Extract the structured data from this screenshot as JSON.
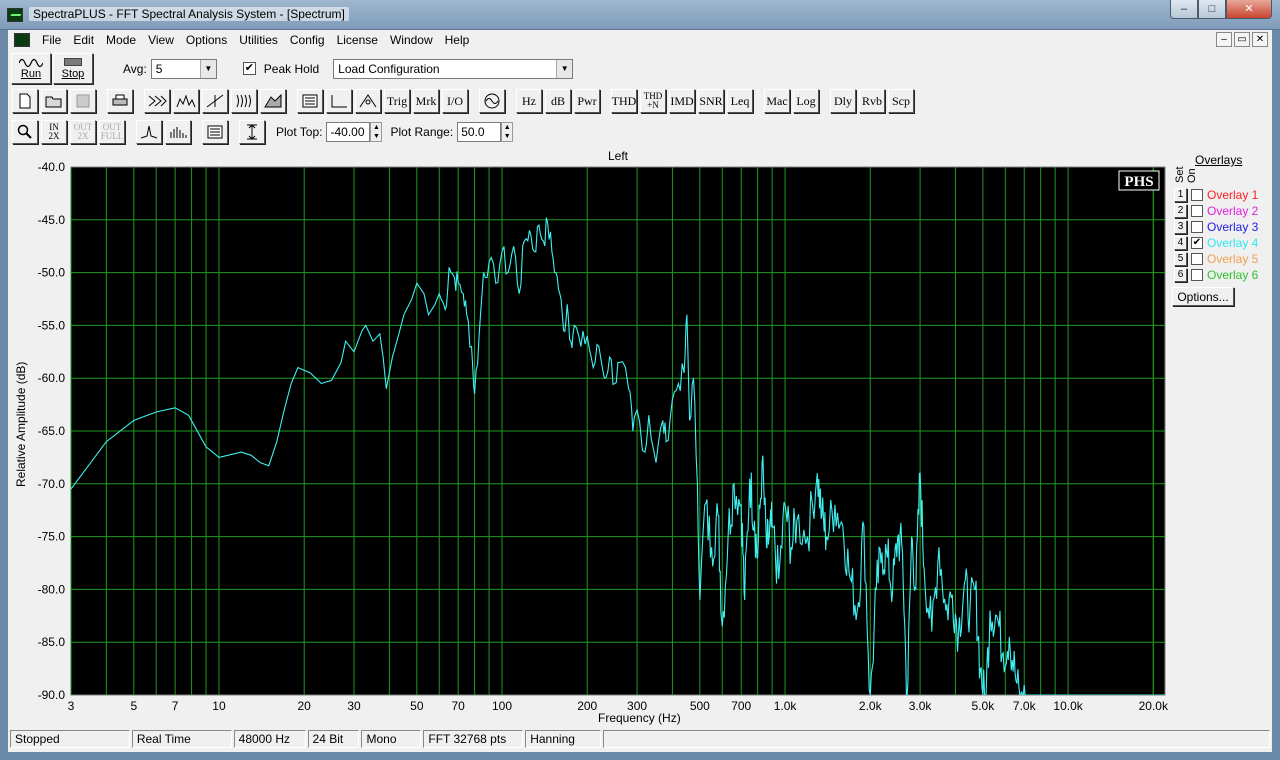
{
  "window": {
    "title": "SpectraPLUS - FFT Spectral Analysis System - [Spectrum]",
    "minimize": "–",
    "maximize": "□",
    "close": "✕"
  },
  "menu": [
    "File",
    "Edit",
    "Mode",
    "View",
    "Options",
    "Utilities",
    "Config",
    "License",
    "Window",
    "Help"
  ],
  "mdi": {
    "min": "–",
    "restore": "▭",
    "close": "✕"
  },
  "toolbar": {
    "run_label": "Run",
    "stop_label": "Stop",
    "avg_label": "Avg:",
    "avg_value": "5",
    "peak_hold_label": "Peak Hold",
    "peak_hold_checked": "✔",
    "config_value": "Load Configuration",
    "row2_text_buttons": [
      "Trig",
      "Mrk",
      "I/O"
    ],
    "units": [
      "Hz",
      "dB",
      "Pwr"
    ],
    "measures": [
      "THD",
      "THD +N",
      "IMD",
      "SNR",
      "Leq"
    ],
    "modes": [
      "Mac",
      "Log"
    ],
    "utils": [
      "Dly",
      "Rvb",
      "Scp"
    ],
    "plot_top_label": "Plot Top:",
    "plot_top_value": "-40.00",
    "plot_range_label": "Plot Range:",
    "plot_range_value": "50.0"
  },
  "overlays": {
    "title": "Overlays",
    "set_label": "Set",
    "on_label": "On",
    "options_label": "Options...",
    "items": [
      {
        "num": "1",
        "name": "Overlay 1",
        "color": "#ff2020",
        "checked": ""
      },
      {
        "num": "2",
        "name": "Overlay 2",
        "color": "#e020e0",
        "checked": ""
      },
      {
        "num": "3",
        "name": "Overlay 3",
        "color": "#2020e0",
        "checked": ""
      },
      {
        "num": "4",
        "name": "Overlay 4",
        "color": "#30e8f0",
        "checked": "✔"
      },
      {
        "num": "5",
        "name": "Overlay 5",
        "color": "#f0a050",
        "checked": ""
      },
      {
        "num": "6",
        "name": "Overlay 6",
        "color": "#30c030",
        "checked": ""
      }
    ]
  },
  "status": [
    "Stopped",
    "Real Time",
    "48000 Hz",
    "24 Bit",
    "Mono",
    "FFT 32768 pts",
    "Hanning"
  ],
  "chart_data": {
    "type": "line",
    "title": "Left",
    "xlabel": "Frequency (Hz)",
    "ylabel": "Relative Amplitude (dB)",
    "xscale": "log",
    "xlim": [
      3,
      22000
    ],
    "ylim": [
      -90,
      -40
    ],
    "grid": true,
    "background": "#000000",
    "grid_color": "#1f9a1f",
    "line_color": "#40f0f0",
    "watermark": "PHS",
    "y_ticks": [
      "-40.0",
      "-45.0",
      "-50.0",
      "-55.0",
      "-60.0",
      "-65.0",
      "-70.0",
      "-75.0",
      "-80.0",
      "-85.0",
      "-90.0"
    ],
    "x_ticks": [
      {
        "v": 3,
        "t": "3"
      },
      {
        "v": 5,
        "t": "5"
      },
      {
        "v": 7,
        "t": "7"
      },
      {
        "v": 10,
        "t": "10"
      },
      {
        "v": 20,
        "t": "20"
      },
      {
        "v": 30,
        "t": "30"
      },
      {
        "v": 50,
        "t": "50"
      },
      {
        "v": 70,
        "t": "70"
      },
      {
        "v": 100,
        "t": "100"
      },
      {
        "v": 200,
        "t": "200"
      },
      {
        "v": 300,
        "t": "300"
      },
      {
        "v": 500,
        "t": "500"
      },
      {
        "v": 700,
        "t": "700"
      },
      {
        "v": 1000,
        "t": "1.0k"
      },
      {
        "v": 2000,
        "t": "2.0k"
      },
      {
        "v": 3000,
        "t": "3.0k"
      },
      {
        "v": 5000,
        "t": "5.0k"
      },
      {
        "v": 7000,
        "t": "7.0k"
      },
      {
        "v": 10000,
        "t": "10.0k"
      },
      {
        "v": 20000,
        "t": "20.0k"
      }
    ],
    "series": [
      {
        "name": "Left",
        "points": [
          [
            3,
            -70.5
          ],
          [
            4,
            -66
          ],
          [
            5,
            -64
          ],
          [
            6,
            -63.2
          ],
          [
            7,
            -62.8
          ],
          [
            7.8,
            -63.5
          ],
          [
            9,
            -66.5
          ],
          [
            10,
            -67.5
          ],
          [
            12,
            -67
          ],
          [
            13,
            -67.3
          ],
          [
            14,
            -68
          ],
          [
            15,
            -68.3
          ],
          [
            16,
            -66
          ],
          [
            17,
            -63
          ],
          [
            18,
            -60.5
          ],
          [
            19,
            -59
          ],
          [
            21,
            -59.5
          ],
          [
            23,
            -60.5
          ],
          [
            25,
            -60.2
          ],
          [
            27,
            -58.5
          ],
          [
            28,
            -56.5
          ],
          [
            30,
            -57.5
          ],
          [
            32,
            -55.5
          ],
          [
            33,
            -55
          ],
          [
            35,
            -56.5
          ],
          [
            37,
            -55.8
          ],
          [
            38,
            -58
          ],
          [
            39,
            -61
          ],
          [
            41,
            -58
          ],
          [
            43,
            -56
          ],
          [
            45,
            -54
          ],
          [
            48,
            -52.5
          ],
          [
            50,
            -51
          ],
          [
            53,
            -52
          ],
          [
            55,
            -54
          ],
          [
            58,
            -53
          ],
          [
            60,
            -52
          ],
          [
            63,
            -53.5
          ],
          [
            65,
            -49.5
          ],
          [
            68,
            -50.5
          ],
          [
            70,
            -51
          ],
          [
            73,
            -52
          ],
          [
            75,
            -54
          ],
          [
            78,
            -57
          ],
          [
            80,
            -61.5
          ],
          [
            83,
            -56
          ],
          [
            86,
            -50
          ],
          [
            90,
            -49
          ],
          [
            95,
            -51
          ],
          [
            100,
            -48
          ],
          [
            105,
            -50
          ],
          [
            110,
            -47.5
          ],
          [
            115,
            -52
          ],
          [
            120,
            -47
          ],
          [
            125,
            -46
          ],
          [
            130,
            -48
          ],
          [
            135,
            -45.5
          ],
          [
            140,
            -47
          ],
          [
            145,
            -45.3
          ],
          [
            150,
            -48
          ],
          [
            155,
            -50
          ],
          [
            160,
            -52
          ],
          [
            165,
            -55.5
          ],
          [
            170,
            -53
          ],
          [
            175,
            -56.5
          ],
          [
            180,
            -55
          ],
          [
            190,
            -57
          ],
          [
            200,
            -56
          ],
          [
            210,
            -59
          ],
          [
            220,
            -57
          ],
          [
            230,
            -60
          ],
          [
            240,
            -58
          ],
          [
            250,
            -60.5
          ],
          [
            260,
            -58.5
          ],
          [
            280,
            -61
          ],
          [
            290,
            -65
          ],
          [
            300,
            -63
          ],
          [
            320,
            -67
          ],
          [
            330,
            -63.5
          ],
          [
            350,
            -68
          ],
          [
            370,
            -64
          ],
          [
            380,
            -66
          ],
          [
            400,
            -62
          ],
          [
            420,
            -60.5
          ],
          [
            440,
            -59.5
          ],
          [
            450,
            -54
          ],
          [
            460,
            -64
          ],
          [
            475,
            -60
          ],
          [
            490,
            -70
          ],
          [
            500,
            -81
          ],
          [
            520,
            -72
          ],
          [
            550,
            -76
          ],
          [
            580,
            -73
          ],
          [
            600,
            -83.5
          ],
          [
            630,
            -74.5
          ],
          [
            660,
            -70
          ],
          [
            700,
            -72
          ],
          [
            720,
            -81
          ],
          [
            750,
            -69.5
          ],
          [
            780,
            -73.5
          ],
          [
            800,
            -77
          ],
          [
            830,
            -68
          ],
          [
            860,
            -76
          ],
          [
            880,
            -75
          ],
          [
            900,
            -74
          ],
          [
            950,
            -79
          ],
          [
            1000,
            -72
          ],
          [
            1050,
            -76
          ],
          [
            1100,
            -73.5
          ],
          [
            1200,
            -75
          ],
          [
            1300,
            -69
          ],
          [
            1350,
            -73
          ],
          [
            1400,
            -75
          ],
          [
            1500,
            -72
          ],
          [
            1600,
            -74
          ],
          [
            1700,
            -79
          ],
          [
            1800,
            -82
          ],
          [
            1900,
            -74
          ],
          [
            2000,
            -91
          ],
          [
            2100,
            -80
          ],
          [
            2200,
            -76.5
          ],
          [
            2300,
            -77
          ],
          [
            2400,
            -80
          ],
          [
            2500,
            -75
          ],
          [
            2600,
            -76.5
          ],
          [
            2700,
            -91
          ],
          [
            2800,
            -75
          ],
          [
            2900,
            -80
          ],
          [
            3000,
            -69
          ],
          [
            3100,
            -78
          ],
          [
            3300,
            -84
          ],
          [
            3500,
            -76
          ],
          [
            3700,
            -82
          ],
          [
            3900,
            -80.5
          ],
          [
            4100,
            -84
          ],
          [
            4300,
            -79.5
          ],
          [
            4500,
            -82
          ],
          [
            4700,
            -80
          ],
          [
            4900,
            -87.5
          ],
          [
            5100,
            -91
          ],
          [
            5300,
            -82
          ],
          [
            5600,
            -82.5
          ],
          [
            5900,
            -86
          ],
          [
            6200,
            -84.5
          ],
          [
            6500,
            -88
          ],
          [
            6800,
            -91
          ],
          [
            7100,
            -90.2
          ],
          [
            8000,
            -90.5
          ],
          [
            10000,
            -90.5
          ],
          [
            15000,
            -90.5
          ],
          [
            20000,
            -90.5
          ],
          [
            22000,
            -90.5
          ]
        ]
      }
    ]
  }
}
